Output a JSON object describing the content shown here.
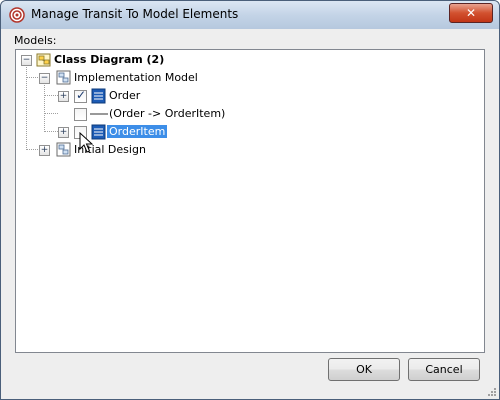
{
  "window": {
    "title": "Manage Transit To Model Elements"
  },
  "models_label": "Models:",
  "tree": {
    "root": {
      "label": "Class Diagram (2)",
      "icon": "class-diagram-icon"
    },
    "implementation_model": {
      "label": "Implementation Model",
      "icon": "model-icon"
    },
    "order": {
      "label": "Order",
      "checked": true,
      "icon": "class-icon"
    },
    "association": {
      "label": "(Order -> OrderItem)",
      "checked": false,
      "icon": "association-icon"
    },
    "order_item": {
      "label": "OrderItem",
      "checked": false,
      "selected": true,
      "icon": "class-icon"
    },
    "initial_design": {
      "label": "Initial Design",
      "icon": "model-icon"
    }
  },
  "buttons": {
    "ok": "OK",
    "cancel": "Cancel"
  },
  "colors": {
    "selection": "#3d8ee8",
    "close": "#c13516",
    "titlebar": "#c4d4e7"
  }
}
